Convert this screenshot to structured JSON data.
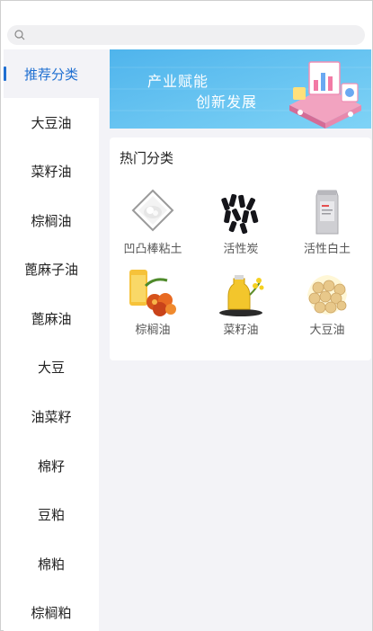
{
  "search": {
    "icon": "search-icon",
    "placeholder": ""
  },
  "sidebar": {
    "items": [
      {
        "label": "推荐分类",
        "active": true
      },
      {
        "label": "大豆油"
      },
      {
        "label": "菜籽油"
      },
      {
        "label": "棕榈油"
      },
      {
        "label": "蓖麻子油"
      },
      {
        "label": "蓖麻油"
      },
      {
        "label": "大豆"
      },
      {
        "label": "油菜籽"
      },
      {
        "label": "棉籽"
      },
      {
        "label": "豆粕"
      },
      {
        "label": "棉粕"
      },
      {
        "label": "棕榈粕"
      }
    ],
    "accent": "#1f6fd1"
  },
  "banner": {
    "line1": "产业赋能",
    "line2": "创新发展"
  },
  "hot": {
    "title": "热门分类",
    "items": [
      {
        "label": "凹凸棒粘土",
        "icon": "clay-powder-icon"
      },
      {
        "label": "活性炭",
        "icon": "activated-carbon-icon"
      },
      {
        "label": "活性白土",
        "icon": "bleaching-earth-bag-icon"
      },
      {
        "label": "棕榈油",
        "icon": "palm-oil-icon"
      },
      {
        "label": "菜籽油",
        "icon": "rapeseed-oil-icon"
      },
      {
        "label": "大豆油",
        "icon": "soybean-oil-icon"
      }
    ]
  }
}
